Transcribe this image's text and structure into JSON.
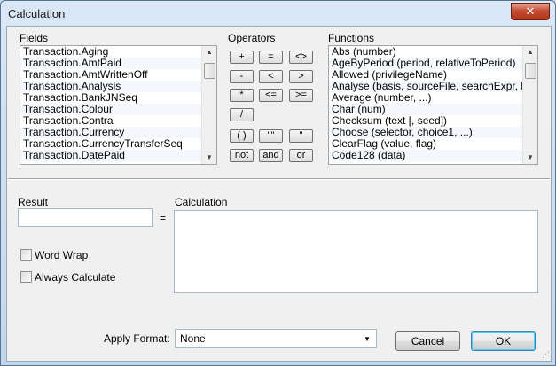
{
  "window": {
    "title": "Calculation",
    "close_glyph": "✕"
  },
  "fields": {
    "label": "Fields",
    "items": [
      "Transaction.Aging",
      "Transaction.AmtPaid",
      "Transaction.AmtWrittenOff",
      "Transaction.Analysis",
      "Transaction.BankJNSeq",
      "Transaction.Colour",
      "Transaction.Contra",
      "Transaction.Currency",
      "Transaction.CurrencyTransferSeq",
      "Transaction.DatePaid"
    ]
  },
  "operators": {
    "label": "Operators",
    "buttons": [
      "+",
      "=",
      "<>",
      "-",
      "<",
      ">",
      "*",
      "<=",
      ">=",
      "/",
      "( )",
      "\"\"",
      "\"",
      "not",
      "and",
      "or"
    ]
  },
  "functions": {
    "label": "Functions",
    "items": [
      "Abs (number)",
      "AgeByPeriod (period, relativeToPeriod)",
      "Allowed (privilegeName)",
      "Analyse (basis, sourceFile, searchExpr, b...",
      "Average (number, ...)",
      "Char (num)",
      "Checksum (text [, seed])",
      "Choose (selector, choice1, ...)",
      "ClearFlag (value, flag)",
      "Code128 (data)"
    ]
  },
  "result": {
    "label": "Result",
    "value": "",
    "equals": "="
  },
  "calculation": {
    "label": "Calculation",
    "value": ""
  },
  "options": {
    "word_wrap": "Word Wrap",
    "always_calculate": "Always Calculate"
  },
  "format": {
    "label": "Apply Format:",
    "selected": "None"
  },
  "buttons": {
    "cancel": "Cancel",
    "ok": "OK"
  }
}
